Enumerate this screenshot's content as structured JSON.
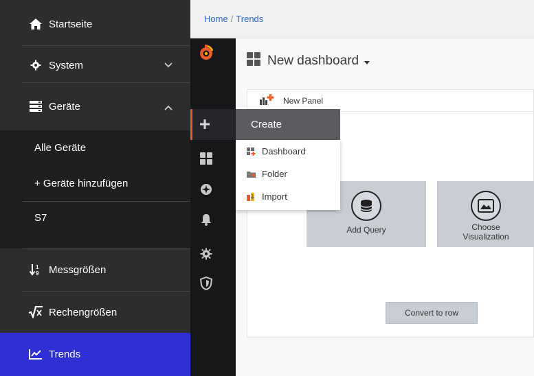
{
  "sidebar": {
    "items": [
      {
        "label": "Startseite",
        "icon": "home-icon"
      },
      {
        "label": "System",
        "icon": "gear-icon"
      },
      {
        "label": "Geräte",
        "icon": "server-icon"
      },
      {
        "label": "Messgrößen",
        "icon": "sort-numeric-icon"
      },
      {
        "label": "Rechengrößen",
        "icon": "square-root-icon"
      },
      {
        "label": "Trends",
        "icon": "chart-line-icon"
      }
    ],
    "sub_items": [
      "Alle Geräte",
      "+ Geräte hinzufügen",
      "S7"
    ],
    "active_color": "#2e30d6"
  },
  "breadcrumb": {
    "home": "Home",
    "separator": "/",
    "current": "Trends"
  },
  "dashboard": {
    "title": "New dashboard",
    "panel_title": "New Panel",
    "add_query": "Add Query",
    "choose_visualization_line1": "Choose",
    "choose_visualization_line2": "Visualization",
    "convert_to_row": "Convert to row"
  },
  "create_menu": {
    "header": "Create",
    "items": [
      "Dashboard",
      "Folder",
      "Import"
    ]
  },
  "colors": {
    "grafana_orange": "#f05a28",
    "link_blue": "#2a66c8"
  }
}
